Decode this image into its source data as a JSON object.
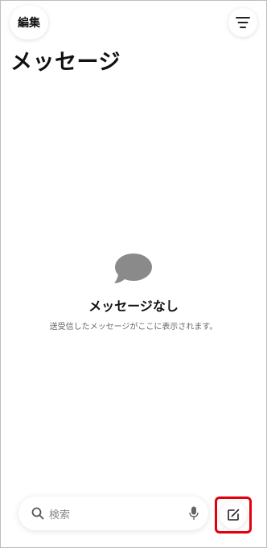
{
  "header": {
    "edit_label": "編集",
    "title": "メッセージ",
    "filter_icon": "filter-lines-icon"
  },
  "empty_state": {
    "icon": "chat-bubble-icon",
    "title": "メッセージなし",
    "subtitle": "送受信したメッセージがここに表示されます。"
  },
  "search": {
    "placeholder": "検索",
    "icon": "search-icon",
    "mic_icon": "microphone-icon"
  },
  "compose": {
    "icon": "compose-icon",
    "highlight_color": "#e3000f"
  },
  "colors": {
    "bubble": "#8a8a8a",
    "text": "#111111",
    "subtext": "#666666"
  }
}
